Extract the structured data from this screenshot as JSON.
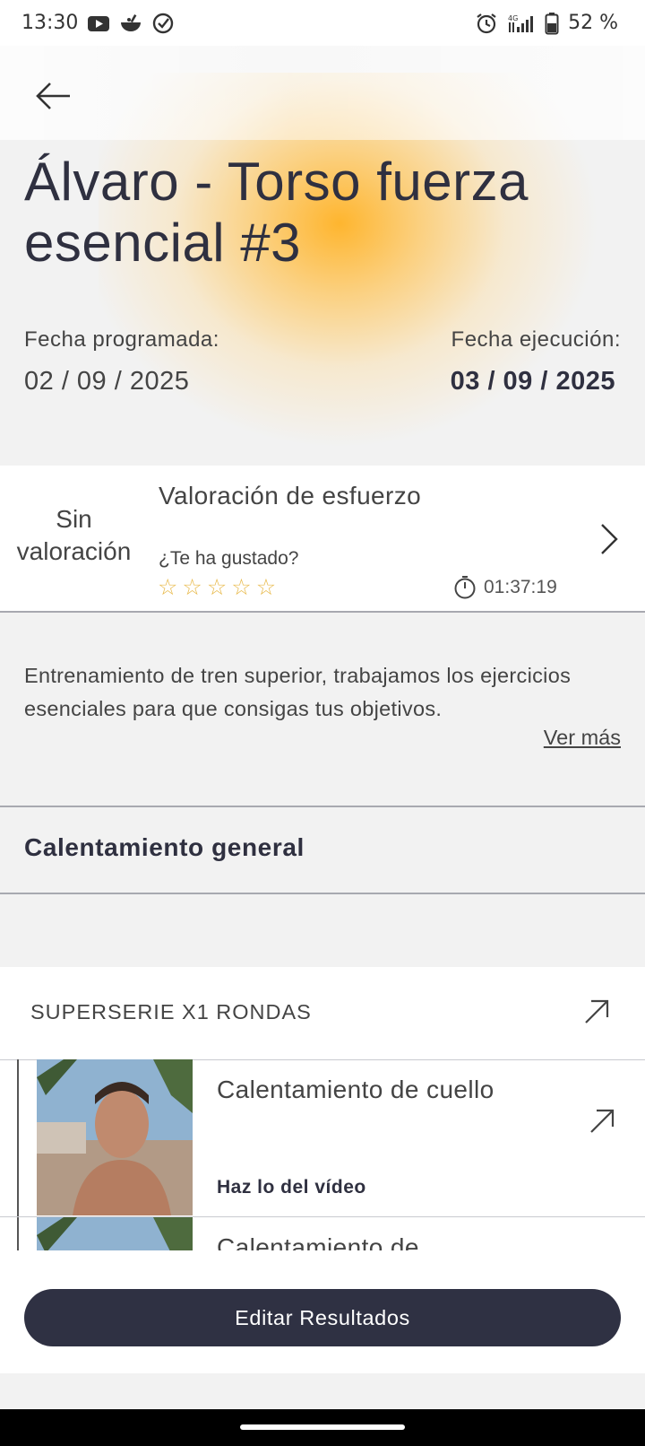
{
  "status_bar": {
    "time": "13:30",
    "battery": "52 %",
    "left_icons": [
      "youtube-icon",
      "bowl-icon",
      "check-circle-icon"
    ],
    "right_icons": [
      "alarm-icon",
      "signal-icon",
      "battery-icon"
    ],
    "network_label": "4G"
  },
  "header": {
    "title": "Álvaro - Torso fuerza esencial #3",
    "scheduled_label": "Fecha programada:",
    "scheduled_date": "02 / 09 / 2025",
    "executed_label": "Fecha ejecución:",
    "executed_date": "03 / 09 / 2025",
    "accent_color": "#ffb224"
  },
  "rating": {
    "no_rating": "Sin valoración",
    "effort_title": "Valoración de esfuerzo",
    "liked_question": "¿Te ha gustado?",
    "stars_total": 5,
    "stars_filled": 0,
    "star_glyph": "☆",
    "duration": "01:37:19",
    "star_color": "#e8b94a"
  },
  "description": {
    "text": "Entrenamiento de tren superior, trabajamos los ejercicios esenciales para que consigas tus objetivos.",
    "see_more": "Ver más"
  },
  "section": {
    "title": "Calentamiento general"
  },
  "superseries": {
    "label": "SUPERSERIE X1 RONDAS",
    "exercises": [
      {
        "name": "Calentamiento de cuello",
        "hint": "Haz lo del vídeo"
      },
      {
        "name": "Calentamiento de",
        "hint": ""
      }
    ]
  },
  "actions": {
    "edit_results": "Editar Resultados",
    "button_color": "#2f3143"
  }
}
